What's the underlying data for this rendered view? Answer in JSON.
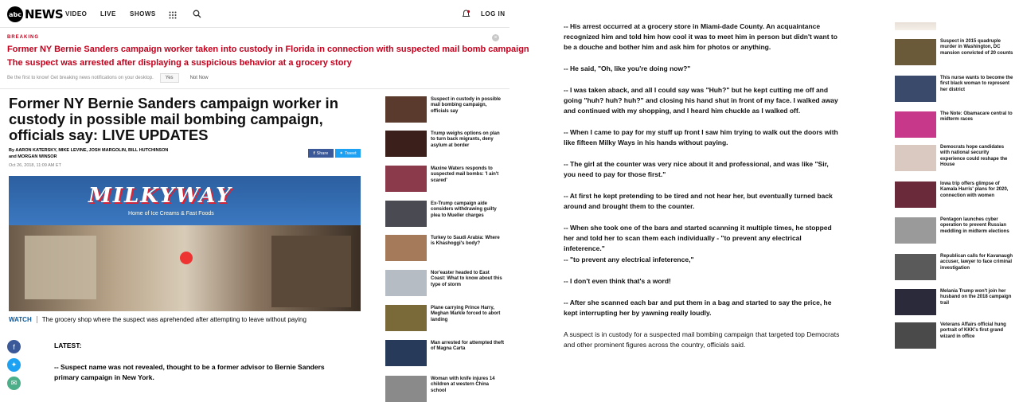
{
  "header": {
    "logo_mark": "abc",
    "logo_text": "NEWS",
    "nav": [
      "VIDEO",
      "LIVE",
      "SHOWS"
    ],
    "login": "LOG IN"
  },
  "breaking": {
    "label": "BREAKING",
    "headlines": [
      "Former NY Bernie Sanders campaign worker taken into custody in Florida in connection with suspected mail bomb campaign",
      "The suspect was arrested after displaying a suspicious behavior at a grocery story"
    ],
    "notify_text": "Be the first to know! Get breaking news notifications on your desktop.",
    "yes": "Yes",
    "not_now": "Not Now"
  },
  "article": {
    "title": "Former NY Bernie Sanders campaign worker in custody in possible mail bombing campaign, officials say: LIVE UPDATES",
    "byline_line1": "By AARON KATERSKY, MIKE LEVINE, JOSH MARGOLIN, BILL HUTCHINSON",
    "byline_line2": "and MORGAN WINSOR",
    "date": "Oct 26, 2018, 11:09 AM ET",
    "share": "Share",
    "tweet": "Tweet",
    "photo_sign": "MILKYWAY",
    "photo_sub": "Home of Ice Creams & Fast Foods",
    "watch": "WATCH",
    "caption": "The grocery shop where the suspect was aprehended after attempting to leave without paying",
    "latest": "LATEST:",
    "body": "-- Suspect name was not revealed, thought to be a former advisor to Bernie Sanders primary campaign in New York."
  },
  "sidebar": [
    {
      "text": "Suspect in custody in possible mail bombing campaign, officials say",
      "color": "#5b3a2e"
    },
    {
      "text": "Trump weighs options on plan to turn back migrants, deny asylum at border",
      "color": "#3a1f1a"
    },
    {
      "text": "Maxine Waters responds to suspected mail bombs: 'I ain't scared'",
      "color": "#8a3a4a"
    },
    {
      "text": "Ex-Trump campaign aide considers withdrawing guilty plea to Mueller charges",
      "color": "#4a4a52"
    },
    {
      "text": "Turkey to Saudi Arabia: Where is Khashoggi's body?",
      "color": "#a57a5a"
    },
    {
      "text": "Nor'easter headed to East Coast: What to know about this type of storm",
      "color": "#b6bcc4"
    },
    {
      "text": "Plane carrying Prince Harry, Meghan Markle forced to abort landing",
      "color": "#7a6a3a"
    },
    {
      "text": "Man arrested for attempted theft of Magna Carta",
      "color": "#283a5a"
    },
    {
      "text": "Woman with knife injures 14 children at western China school",
      "color": "#8a8a8a"
    }
  ],
  "middle": [
    {
      "text": "-- His arrest occurred at a grocery store in Miami-dade County. An acquaintance recognized him and told him how cool it was to meet him in person but didn't want to be a douche and bother him and ask him for photos or anything.",
      "bold": true
    },
    {
      "text": "-- He said, \"Oh, like you're doing now?\"",
      "bold": true
    },
    {
      "text": "-- I was taken aback, and all I could say was \"Huh?\" but he kept cutting me off and going \"huh? huh? huh?\" and closing his hand shut in front of my face. I walked away and continued with my shopping, and I heard him chuckle as I walked off.",
      "bold": true
    },
    {
      "text": "-- When I came to pay for my stuff up front I saw him trying to walk out the doors with like fifteen Milky Ways in his hands without paying.",
      "bold": true
    },
    {
      "text": "-- The girl at the counter was very nice about it and professional, and was like \"Sir, you need to pay for those first.\"",
      "bold": true
    },
    {
      "text": "-- At first he kept pretending to be tired and not hear her, but eventually turned back around and brought them to the counter.",
      "bold": true
    },
    {
      "text": "-- When she took one of the bars and started scanning it multiple times, he stopped her and told her to scan them each individually - \"to prevent any electrical infeterence.\"",
      "bold": true
    },
    {
      "text": "-- \"to prevent any electrical infeterence,\"",
      "bold": true
    },
    {
      "text": "-- I don't even think that's a word!",
      "bold": true
    },
    {
      "text": "-- After she scanned each bar and put them in a bag and started to say the price, he kept interrupting her by yawning really loudly.",
      "bold": true
    },
    {
      "text": "A suspect is in custody for a suspected mail bombing campaign that targeted top Democrats and other prominent figures across the country, officials said.",
      "bold": false
    }
  ],
  "right_rail": [
    {
      "text": "Suspect in 2015 quadruple murder in Washington, DC mansion convicted of 20 counts",
      "color": "#6a5a3a"
    },
    {
      "text": "This nurse wants to become the first black woman to represent her district",
      "color": "#3a4a6a"
    },
    {
      "text": "The Note: Obamacare central to midterm races",
      "color": "#c8388a"
    },
    {
      "text": "Democrats hope candidates with national security experience could reshape the House",
      "color": "#d9c9c0"
    },
    {
      "text": "Iowa trip offers glimpse of Kamala Harris' plans for 2020, connection with women",
      "color": "#6a2a3a"
    },
    {
      "text": "Pentagon launches cyber operation to prevent Russian meddling in midterm elections",
      "color": "#9a9a9a"
    },
    {
      "text": "Republican calls for Kavanaugh accuser, lawyer to face criminal investigation",
      "color": "#5a5a5a"
    },
    {
      "text": "Melania Trump won't join her husband on the 2018 campaign trail",
      "color": "#2a2a3a"
    },
    {
      "text": "Veterans Affairs official hung portrait of KKK's first grand wizard in office",
      "color": "#4a4a4a"
    }
  ],
  "colors": {
    "breaking": "#c4001c",
    "facebook": "#3b5998",
    "twitter": "#1da1f2",
    "link": "#0a5a9c"
  }
}
